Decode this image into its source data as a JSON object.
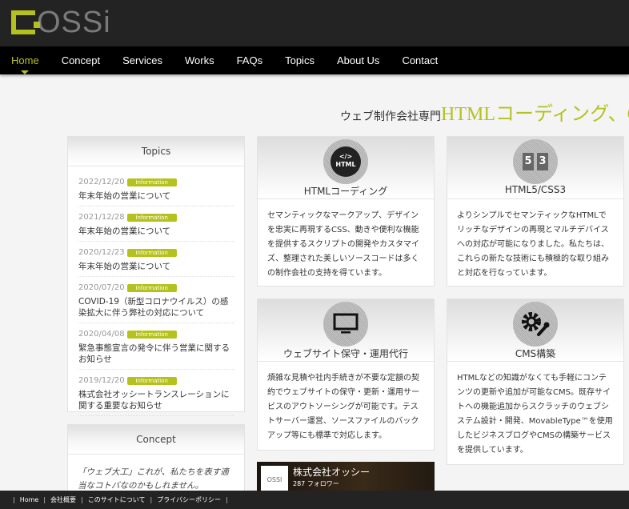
{
  "header": {
    "logo_text": "OSSi"
  },
  "nav": {
    "items": [
      {
        "label": "Home",
        "active": true
      },
      {
        "label": "Concept"
      },
      {
        "label": "Services"
      },
      {
        "label": "Works"
      },
      {
        "label": "FAQs"
      },
      {
        "label": "Topics"
      },
      {
        "label": "About Us"
      },
      {
        "label": "Contact"
      }
    ]
  },
  "tagline": {
    "prefix": "ウェブ制作会社専門",
    "highlight": "HTMLコーディング、CM"
  },
  "topics": {
    "title": "Topics",
    "items": [
      {
        "date": "2022/12/20",
        "badge": "Information",
        "title": "年末年始の営業について"
      },
      {
        "date": "2021/12/28",
        "badge": "Information",
        "title": "年末年始の営業について"
      },
      {
        "date": "2020/12/23",
        "badge": "Information",
        "title": "年末年始の営業について"
      },
      {
        "date": "2020/07/20",
        "badge": "Information",
        "title": "COVID-19（新型コロナウイルス）の感染拡大に伴う弊社の対応について"
      },
      {
        "date": "2020/04/08",
        "badge": "Information",
        "title": "緊急事態宣言の発令に伴う営業に関するお知らせ"
      },
      {
        "date": "2019/12/20",
        "badge": "Information",
        "title": "株式会社オッシートランスレーションに関する重要なお知らせ"
      }
    ]
  },
  "concept": {
    "title": "Concept",
    "text": "「ウェブ大工」これが、私たちを表す適当なコトバなのかもしれません。"
  },
  "services": [
    {
      "icon": "html-icon",
      "title": "HTMLコーディング",
      "body": "セマンティックなマークアップ、デザインを忠実に再現するCSS、動きや便利な機能を提供するスクリプトの開発やカスタマイズ、整理された美しいソースコードは多くの制作会社の支持を得ています。"
    },
    {
      "icon": "html5-css3-icon",
      "title": "HTML5/CSS3",
      "body": "よりシンプルでセマンティックなHTMLでリッチなデザインの再現とマルチデバイスへの対応が可能になりました。私たちは、これらの新たな技術にも積極的な取り組みと対応を行なっています。"
    },
    {
      "icon": "monitor-icon",
      "title": "ウェブサイト保守・運用代行",
      "body": "煩雑な見積や社内手続きが不要な定額の契約でウェブサイトの保守・更新・運用サービスのアウトソーシングが可能です。テストサーバー運営、ソースファイルのバックアップ等にも標準で対応します。"
    },
    {
      "icon": "gear-wrench-icon",
      "title": "CMS構築",
      "body": "HTMLなどの知識がなくても手軽にコンテンツの更新や追加が可能なCMS。既存サイトへの機能追加からスクラッチのウェブシステム設計・開発、MovableType™を使用したビジネスブログやCMSの構築サービスを提供しています。"
    }
  ],
  "facebook": {
    "logo_text": "OSSI",
    "name": "株式会社オッシー",
    "followers": "287 フォロワー"
  },
  "footer": {
    "links": [
      "Home",
      "会社概要",
      "このサイトについて",
      "プライバシーポリシー"
    ]
  },
  "colors": {
    "accent": "#b5c21e",
    "header_bg": "#232323",
    "nav_bg": "#000000"
  }
}
